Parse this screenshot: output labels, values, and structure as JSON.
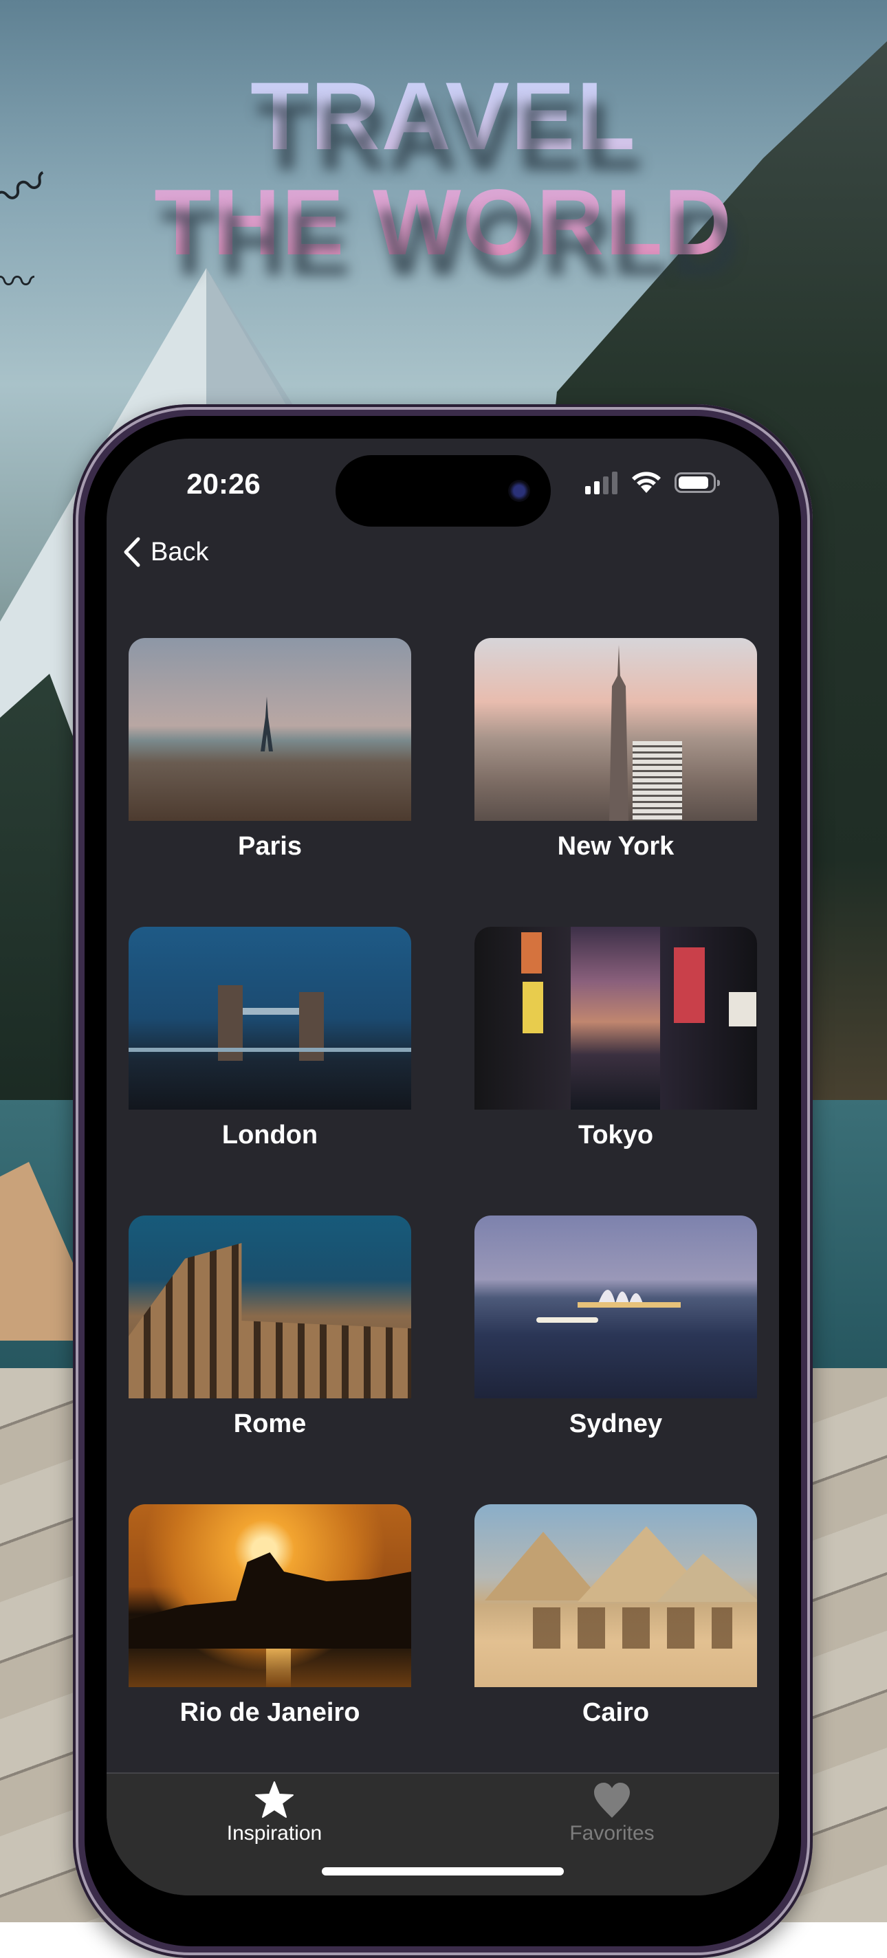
{
  "promo": {
    "headline_line1": "TRAVEL",
    "headline_line2": "THE WORLD",
    "gradient_top": "#c5d2f8",
    "gradient_bottom": "#df8bb7"
  },
  "status_bar": {
    "time": "20:26",
    "signal_bars_active": 2,
    "signal_bars_total": 4,
    "wifi": "wifi-icon",
    "battery": "battery-icon"
  },
  "nav": {
    "back_label": "Back",
    "back_icon": "chevron-left-icon"
  },
  "destinations": [
    {
      "name": "Paris",
      "image": "paris-skyline-eiffel-tower"
    },
    {
      "name": "New York",
      "image": "new-york-skyline-empire-state"
    },
    {
      "name": "London",
      "image": "london-tower-bridge-night"
    },
    {
      "name": "Tokyo",
      "image": "tokyo-neon-street-dusk"
    },
    {
      "name": "Rome",
      "image": "rome-colosseum"
    },
    {
      "name": "Sydney",
      "image": "sydney-opera-house-harbour"
    },
    {
      "name": "Rio de Janeiro",
      "image": "rio-sunset-christ-redeemer"
    },
    {
      "name": "Cairo",
      "image": "cairo-pyramids-camels"
    }
  ],
  "tab_bar": {
    "tabs": [
      {
        "label": "Inspiration",
        "icon": "star-icon",
        "selected": true
      },
      {
        "label": "Favorites",
        "icon": "heart-icon",
        "selected": false
      }
    ],
    "active_color": "#ffffff",
    "inactive_color": "#7d7d7d"
  }
}
